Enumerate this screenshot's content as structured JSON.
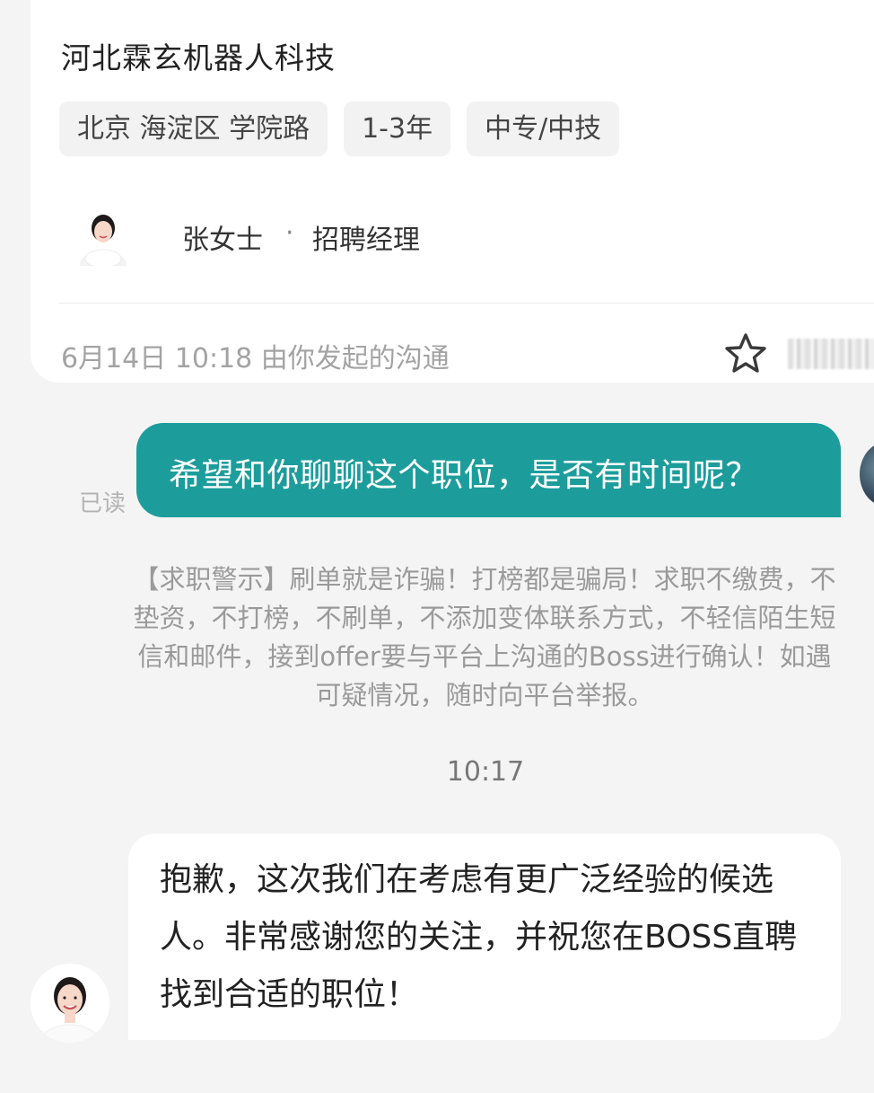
{
  "job": {
    "company": "河北霖玄机器人科技",
    "tags": [
      "北京 海淀区 学院路",
      "1-3年",
      "中专/中技"
    ],
    "recruiter": {
      "name": "张女士",
      "separator": "·",
      "title": "招聘经理"
    },
    "chat_meta": "6月14日 10:18 由你发起的沟通",
    "favorite_icon": "star-outline-icon"
  },
  "messages": {
    "outgoing": {
      "text": "希望和你聊聊这个职位，是否有时间呢？",
      "status": "已读",
      "bubble_color": "#1c9d9c"
    },
    "warning": "【求职警示】刷单就是诈骗！打榜都是骗局！求职不缴费，不垫资，不打榜，不刷单，不添加变体联系方式，不轻信陌生短信和邮件，接到offer要与平台上沟通的Boss进行确认！如遇可疑情况，随时向平台举报。",
    "timestamp": "10:17",
    "incoming": {
      "text": "抱歉，这次我们在考虑有更广泛经验的候选人。非常感谢您的关注，并祝您在BOSS直聘找到合适的职位！"
    }
  }
}
